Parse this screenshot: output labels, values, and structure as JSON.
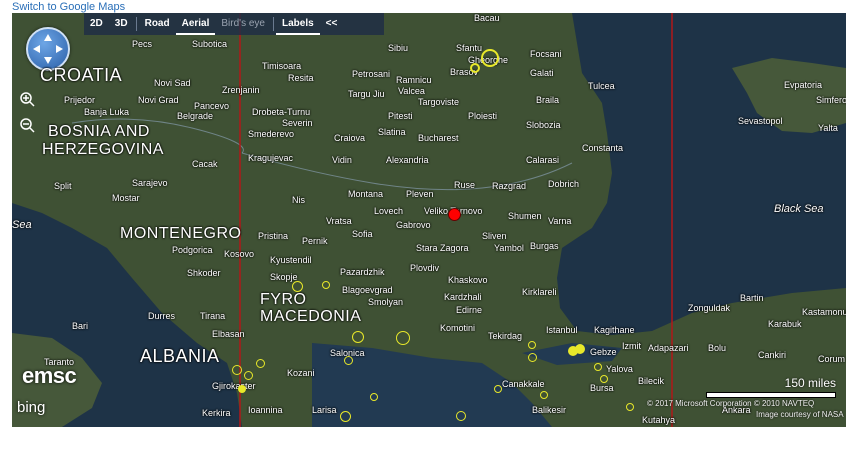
{
  "switch_link": "Switch to Google Maps",
  "toolbar": {
    "items": [
      "2D",
      "3D",
      "Road",
      "Aerial",
      "Bird's eye",
      "Labels",
      "<<"
    ]
  },
  "colors": {
    "land": "#3f5134",
    "sea": "#1e3347",
    "tz_line": "#b01818",
    "quake_yellow": "#e8e82a",
    "quake_red": "#ff0000"
  },
  "labels": {
    "countries": [
      "CROATIA",
      "BOSNIA AND",
      "HERZEGOVINA",
      "MONTENEGRO",
      "ALBANIA",
      "FYRO",
      "MACEDONIA"
    ],
    "seas": [
      "Black Sea",
      "Sea"
    ],
    "cities": [
      "Pecs",
      "Subotica",
      "Novi Sad",
      "Zrenjanin",
      "Prijedor",
      "Banja Luka",
      "Novi Grad",
      "Pancevo",
      "Belgrade",
      "Timisoara",
      "Resita",
      "Drobeta-Turnu",
      "Severin",
      "Smederevo",
      "Kragujevac",
      "Cacak",
      "Sarajevo",
      "Split",
      "Mostar",
      "Nis",
      "Podgorica",
      "Shkoder",
      "Pristina",
      "Kosovo",
      "Kyustendil",
      "Skopje",
      "Durres",
      "Tirana",
      "Elbasan",
      "Bari",
      "Taranto",
      "Gjirokaster",
      "Kozani",
      "Ioannina",
      "Larisa",
      "Kerkira",
      "Sibiu",
      "Sfantu",
      "Gheorghe",
      "Brasov",
      "Focsani",
      "Galati",
      "Tulcea",
      "Braila",
      "Petrosani",
      "Ramnicu",
      "Valcea",
      "Targu Jiu",
      "Targoviste",
      "Ploiesti",
      "Pitesti",
      "Slobozia",
      "Bucharest",
      "Craiova",
      "Slatina",
      "Constanta",
      "Calarasi",
      "Vidin",
      "Alexandria",
      "Montana",
      "Pleven",
      "Ruse",
      "Razgrad",
      "Dobrich",
      "Lovech",
      "Veliko Tarnovo",
      "Shumen",
      "Varna",
      "Vratsa",
      "Gabrovo",
      "Sofia",
      "Pernik",
      "Stara Zagora",
      "Sliven",
      "Yambol",
      "Burgas",
      "Plovdiv",
      "Pazardzhik",
      "Blagoevgrad",
      "Smolyan",
      "Khaskovo",
      "Kardzhali",
      "Edirne",
      "Kirklareli",
      "Komotini",
      "Tekirdag",
      "Istanbul",
      "Kagithane",
      "Gebze",
      "Izmit",
      "Adapazari",
      "Bolu",
      "Yalova",
      "Bursa",
      "Bilecik",
      "Kutahya",
      "Canakkale",
      "Balikesir",
      "Salonica",
      "Sevastopol",
      "Yalta",
      "Evpatoria",
      "Simferopol",
      "Zonguldak",
      "Bartin",
      "Karabuk",
      "Kastamonu",
      "Cankiri",
      "Corum",
      "Ankara",
      "Bacau"
    ]
  },
  "scale_label": "150 miles",
  "copyright": "© 2017 Microsoft Corporation  © 2010 NAVTEQ",
  "imagery": "Image courtesy of NASA",
  "brand_emsc": "emsc",
  "brand_bing": "bing"
}
